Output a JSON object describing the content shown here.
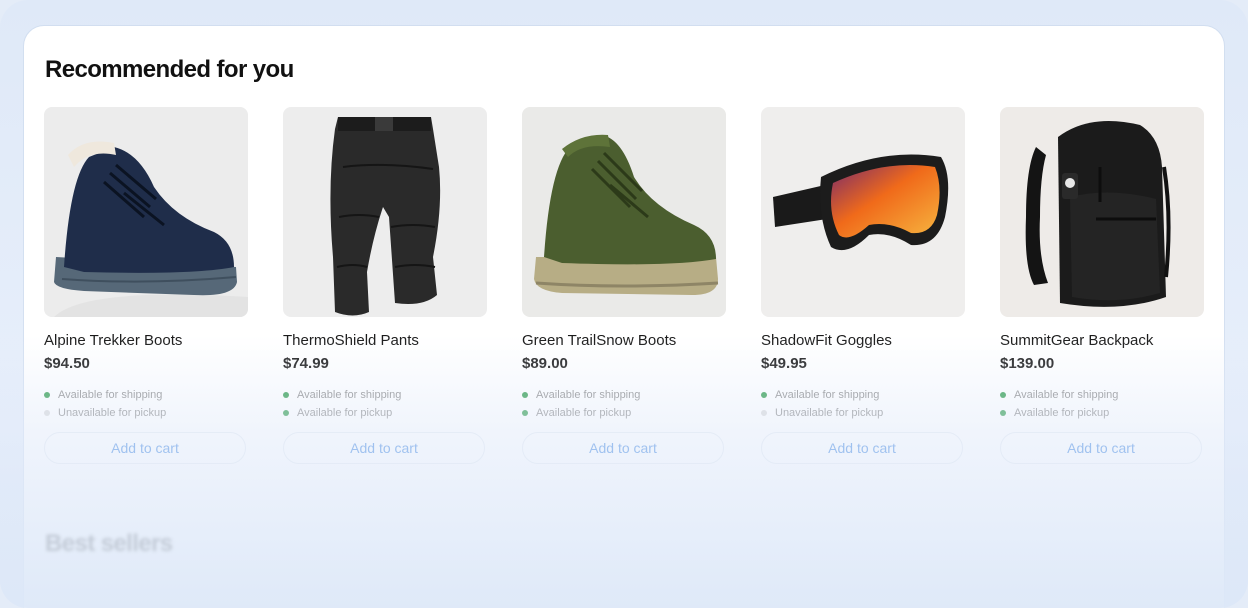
{
  "section_title": "Recommended for you",
  "next_section_title": "Best sellers",
  "products": [
    {
      "name": "Alpine Trekker Boots",
      "price": "$94.50",
      "image": "navy-winter-boot",
      "shipping": {
        "label": "Available for shipping",
        "available": true
      },
      "pickup": {
        "label": "Unavailable for pickup",
        "available": false
      },
      "cta": "Add to cart"
    },
    {
      "name": "ThermoShield Pants",
      "price": "$74.99",
      "image": "black-insulated-pants",
      "shipping": {
        "label": "Available for shipping",
        "available": true
      },
      "pickup": {
        "label": "Available for pickup",
        "available": true
      },
      "cta": "Add to cart"
    },
    {
      "name": "Green TrailSnow Boots",
      "price": "$89.00",
      "image": "green-hiking-boot",
      "shipping": {
        "label": "Available for shipping",
        "available": true
      },
      "pickup": {
        "label": "Available for pickup",
        "available": true
      },
      "cta": "Add to cart"
    },
    {
      "name": "ShadowFit Goggles",
      "price": "$49.95",
      "image": "ski-goggles",
      "shipping": {
        "label": "Available for shipping",
        "available": true
      },
      "pickup": {
        "label": "Unavailable for pickup",
        "available": false
      },
      "cta": "Add to cart"
    },
    {
      "name": "SummitGear Backpack",
      "price": "$139.00",
      "image": "black-backpack",
      "shipping": {
        "label": "Available for shipping",
        "available": true
      },
      "pickup": {
        "label": "Available for pickup",
        "available": true
      },
      "cta": "Add to cart"
    }
  ],
  "colors": {
    "accent": "#3f86e0",
    "available": "#2e9b4b",
    "unavailable": "#d9d9d9"
  }
}
